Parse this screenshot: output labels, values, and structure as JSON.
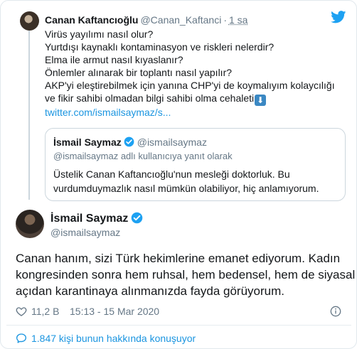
{
  "colors": {
    "brand": "#1da1f2",
    "link": "#1b95e0",
    "text": "#14171a",
    "muted": "#657786",
    "border": "#ccd6dd",
    "emoji_arrow": "#3b88c3"
  },
  "icons": {
    "brand": "twitter-bird-icon",
    "verified": "verified-badge-icon",
    "like": "heart-icon",
    "info": "info-icon",
    "conversation": "speech-bubble-icon",
    "emoji": "down-arrow-emoji"
  },
  "parent_tweet": {
    "author_name": "Canan Kaftancıoğlu",
    "author_handle": "@Canan_Kaftanci",
    "separator": "·",
    "time": "1 sa",
    "lines": [
      "Virüs yayılımı nasıl olur?",
      "Yurtdışı kaynaklı kontaminasyon ve riskleri nelerdir?",
      "Elma ile armut nasıl kıyaslanır?",
      "Önlemler alınarak bir toplantı nasıl yapılır?",
      "AKP'yi eleştirebilmek için yanına CHP'yi de koymalıyım kolaycılığı",
      "ve fikir sahibi olmadan bilgi sahibi olma cehaleti"
    ],
    "emoji_char": "⬇",
    "link": "twitter.com/ismailsaymaz/s..."
  },
  "quoted_tweet": {
    "author_name": "İsmail Saymaz",
    "author_handle": "@ismailsaymaz",
    "reply_context": "@ismailsaymaz adlı kullanıcıya yanıt olarak",
    "text": "Üstelik Canan Kaftancıoğlu'nun mesleği doktorluk. Bu vurdumduymazlık nasıl mümkün olabiliyor, hiç anlamıyorum."
  },
  "main_tweet": {
    "author_name": "İsmail Saymaz",
    "author_handle": "@ismailsaymaz",
    "lines": [
      "Canan hanım, sizi Türk hekimlerine emanet ediyorum. Kadın",
      "kongresinden sonra hem ruhsal, hem bedensel, hem de siyasal",
      "açıdan karantinaya alınmanızda fayda görüyorum."
    ],
    "likes": "11,2 B",
    "timestamp": "15:13 - 15 Mar 2020",
    "conversation": "1.847 kişi bunun hakkında konuşuyor"
  }
}
